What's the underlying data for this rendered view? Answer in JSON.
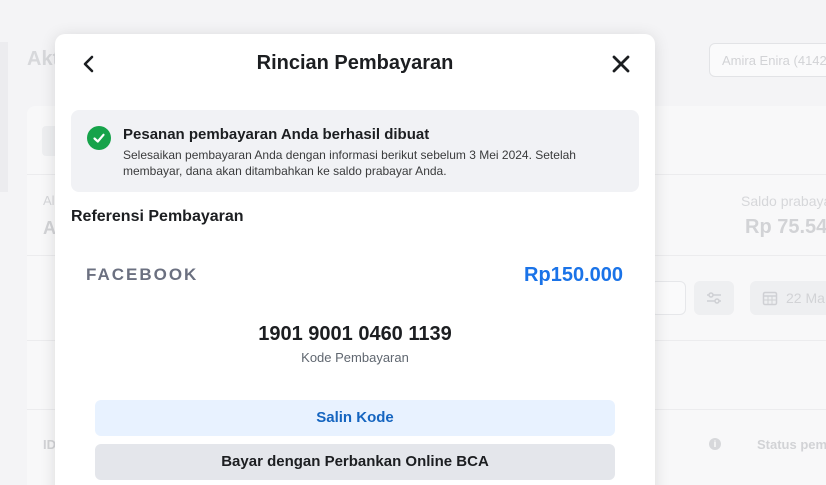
{
  "background": {
    "page_title": "Akt",
    "user_field": "Amira Enira (4142",
    "left_label": "Al",
    "left_value": "A",
    "saldo_label": "Saldo prabaya",
    "saldo_value": "Rp 75.54",
    "date_filter": "22 Ma",
    "col_id": "ID",
    "col_status": "Status pem",
    "info_icon": "info-icon",
    "filter_icon": "sliders-icon",
    "calendar_icon": "calendar-icon"
  },
  "modal": {
    "title": "Rincian Pembayaran",
    "back_icon": "chevron-left-icon",
    "close_icon": "close-icon",
    "alert": {
      "icon": "check-circle-icon",
      "color": "#16a34a",
      "title": "Pesanan pembayaran Anda berhasil dibuat",
      "body": "Selesaikan pembayaran Anda dengan informasi berikut sebelum 3 Mei 2024. Setelah membayar, dana akan ditambahkan ke saldo prabayar Anda."
    },
    "reference": {
      "section_title": "Referensi Pembayaran",
      "merchant": "FACEBOOK",
      "amount": "Rp150.000",
      "amount_color": "#1a73e8",
      "code": "1901 9001 0460 1139",
      "code_label": "Kode Pembayaran"
    },
    "buttons": {
      "copy_label": "Salin Kode",
      "bca_label": "Bayar dengan Perbankan Online BCA"
    }
  }
}
